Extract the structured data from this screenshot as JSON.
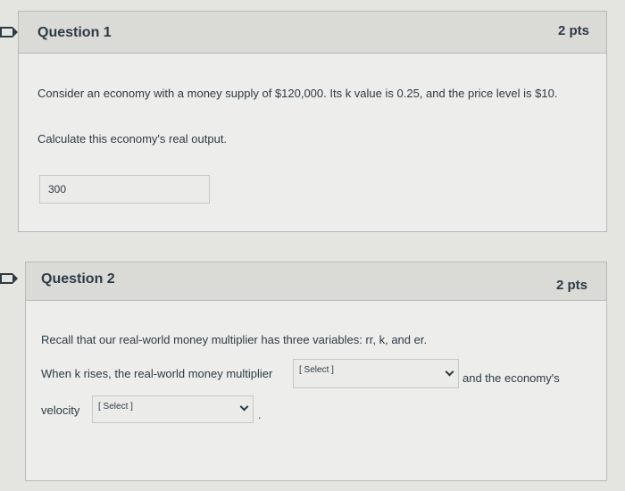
{
  "question1": {
    "title": "Question 1",
    "points": "2 pts",
    "text_line1": "Consider an economy with a money supply of $120,000.  Its k value is 0.25, and the price level is $10.",
    "text_line2": "Calculate this economy's real output.",
    "answer_value": "300"
  },
  "question2": {
    "title": "Question 2",
    "points": "2 pts",
    "intro": "Recall that our real-world money multiplier has three variables: rr, k, and er.",
    "sentence_part1": "When k rises, the real-world money multiplier",
    "select1_value": "[ Select ]",
    "sentence_part2": "and the economy's",
    "velocity_label": "velocity",
    "select2_value": "[ Select ]",
    "trailing_period": "."
  }
}
